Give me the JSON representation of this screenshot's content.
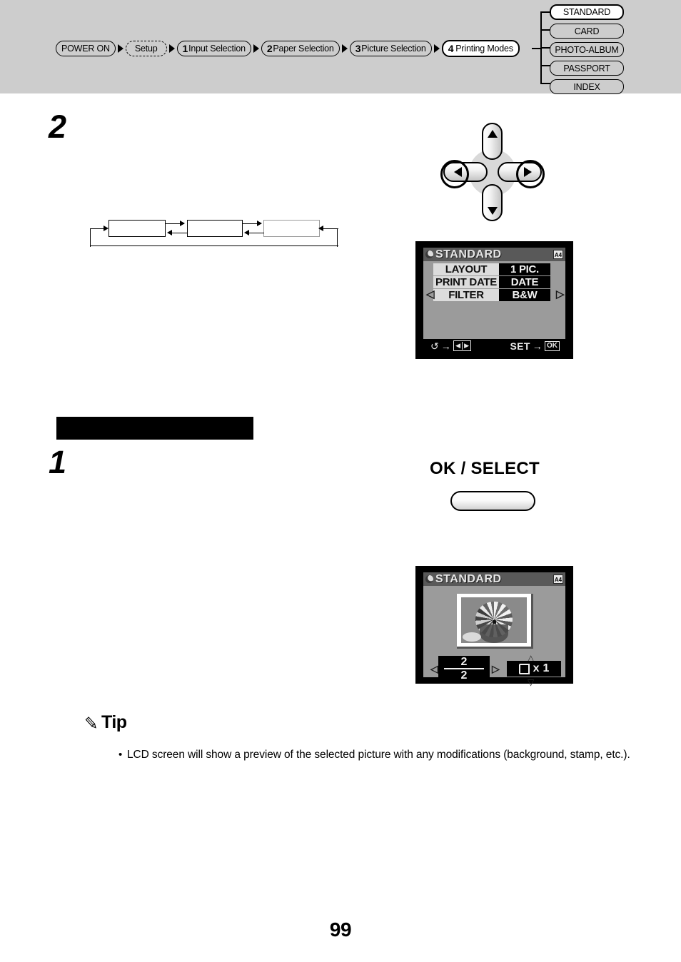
{
  "nav": {
    "breadcrumb": [
      {
        "num": "",
        "label": "POWER ON",
        "style": "solid",
        "active": false
      },
      {
        "num": "",
        "label": "Setup",
        "style": "dashed",
        "active": false
      },
      {
        "num": "1",
        "label": "Input Selection",
        "style": "solid",
        "active": false
      },
      {
        "num": "2",
        "label": "Paper Selection",
        "style": "solid",
        "active": false
      },
      {
        "num": "3",
        "label": "Picture Selection",
        "style": "solid",
        "active": false
      },
      {
        "num": "4",
        "label": "Printing Modes",
        "style": "solid",
        "active": true
      }
    ],
    "modes": [
      {
        "label": "STANDARD",
        "selected": true
      },
      {
        "label": "CARD",
        "selected": false
      },
      {
        "label": "PHOTO-ALBUM",
        "selected": false
      },
      {
        "label": "PASSPORT",
        "selected": false
      },
      {
        "label": "INDEX",
        "selected": false
      }
    ],
    "band_color": "#cdcdcd"
  },
  "steps": {
    "step_two": "2",
    "step_one": "1"
  },
  "flow_diagram": {
    "boxes": [
      "",
      "",
      ""
    ]
  },
  "controls": {
    "dpad": {
      "up": "▲",
      "down": "▼",
      "left": "◀",
      "right": "▶"
    },
    "ok_select_label": "OK / SELECT",
    "ok_button_text": ""
  },
  "lcd_menu": {
    "title": "STANDARD",
    "paper_icon": "A4",
    "rows": [
      {
        "label": "LAYOUT",
        "value": "1 PIC."
      },
      {
        "label": "PRINT DATE",
        "value": "DATE"
      },
      {
        "label": "FILTER",
        "value": "B&W"
      }
    ],
    "caret_left": "◁",
    "caret_right": "▷",
    "footer": {
      "cycle_icon": "↺",
      "arrow": "→",
      "lr_left": "◀",
      "lr_right": "▶",
      "set_label": "SET",
      "ok_badge": "OK"
    }
  },
  "lcd_preview": {
    "title": "STANDARD",
    "paper_icon": "A4",
    "photo_alt": "parachute",
    "picture_index": "2",
    "picture_total": "2",
    "copies_prefix": "x",
    "copies": "1",
    "caret_left": "◁",
    "caret_right": "▷",
    "caret_up": "△",
    "caret_down": "▽"
  },
  "tip": {
    "icon": "pencil-icon",
    "title": "Tip",
    "bullet": "•",
    "text": "LCD screen will show a preview of the selected picture with any modifications (background, stamp, etc.)."
  },
  "page": {
    "number": "99"
  }
}
